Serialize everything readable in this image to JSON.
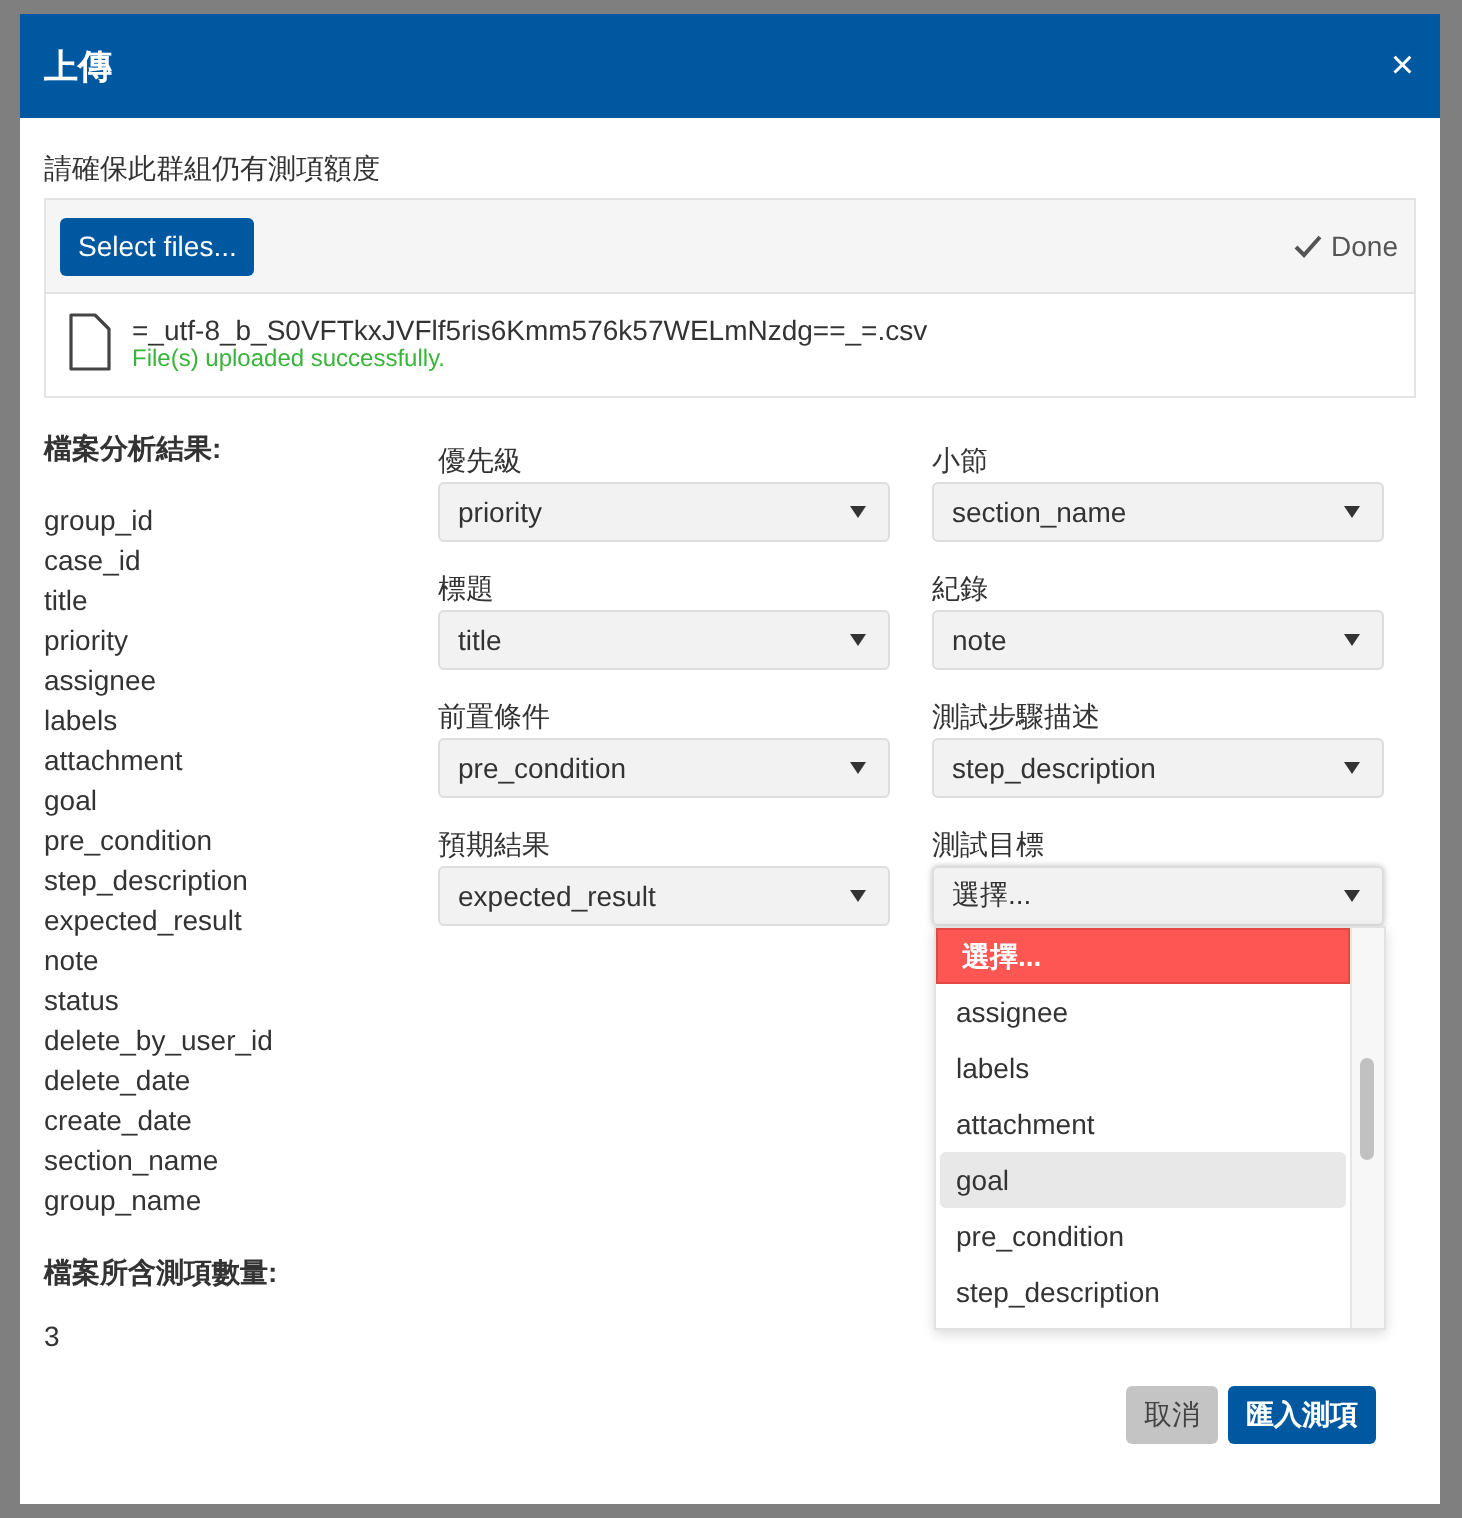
{
  "dialog": {
    "title": "上傳",
    "close": "×"
  },
  "notice": "請確保此群組仍有測項額度",
  "upload": {
    "button": "Select files...",
    "status": "Done",
    "file_name": "=_utf-8_b_S0VFTkxJVFlf5ris6Kmm576k57WELmNzdg==_=.csv",
    "message": "File(s) uploaded successfully."
  },
  "analysis": {
    "heading": "檔案分析結果:",
    "fields": [
      "group_id",
      "case_id",
      "title",
      "priority",
      "assignee",
      "labels",
      "attachment",
      "goal",
      "pre_condition",
      "step_description",
      "expected_result",
      "note",
      "status",
      "delete_by_user_id",
      "delete_date",
      "create_date",
      "section_name",
      "group_name"
    ],
    "count_heading": "檔案所含測項數量:",
    "count": "3"
  },
  "mappings": [
    {
      "label": "優先級",
      "value": "priority",
      "expanded": false
    },
    {
      "label": "小節",
      "value": "section_name",
      "expanded": false
    },
    {
      "label": "標題",
      "value": "title",
      "expanded": false
    },
    {
      "label": "紀錄",
      "value": "note",
      "expanded": false
    },
    {
      "label": "前置條件",
      "value": "pre_condition",
      "expanded": false
    },
    {
      "label": "測試步驟描述",
      "value": "step_description",
      "expanded": false
    },
    {
      "label": "預期結果",
      "value": "expected_result",
      "expanded": false
    },
    {
      "label": "測試目標",
      "value": "選擇...",
      "expanded": true,
      "options": [
        {
          "label": "選擇...",
          "selected": true,
          "highlighted": false
        },
        {
          "label": "assignee",
          "selected": false,
          "highlighted": false
        },
        {
          "label": "labels",
          "selected": false,
          "highlighted": false
        },
        {
          "label": "attachment",
          "selected": false,
          "highlighted": false
        },
        {
          "label": "goal",
          "selected": false,
          "highlighted": true
        },
        {
          "label": "pre_condition",
          "selected": false,
          "highlighted": false
        },
        {
          "label": "step_description",
          "selected": false,
          "highlighted": false
        }
      ]
    }
  ],
  "buttons": [
    {
      "label": "取消",
      "kind": "secondary"
    },
    {
      "label": "匯入測項",
      "kind": "primary"
    }
  ]
}
